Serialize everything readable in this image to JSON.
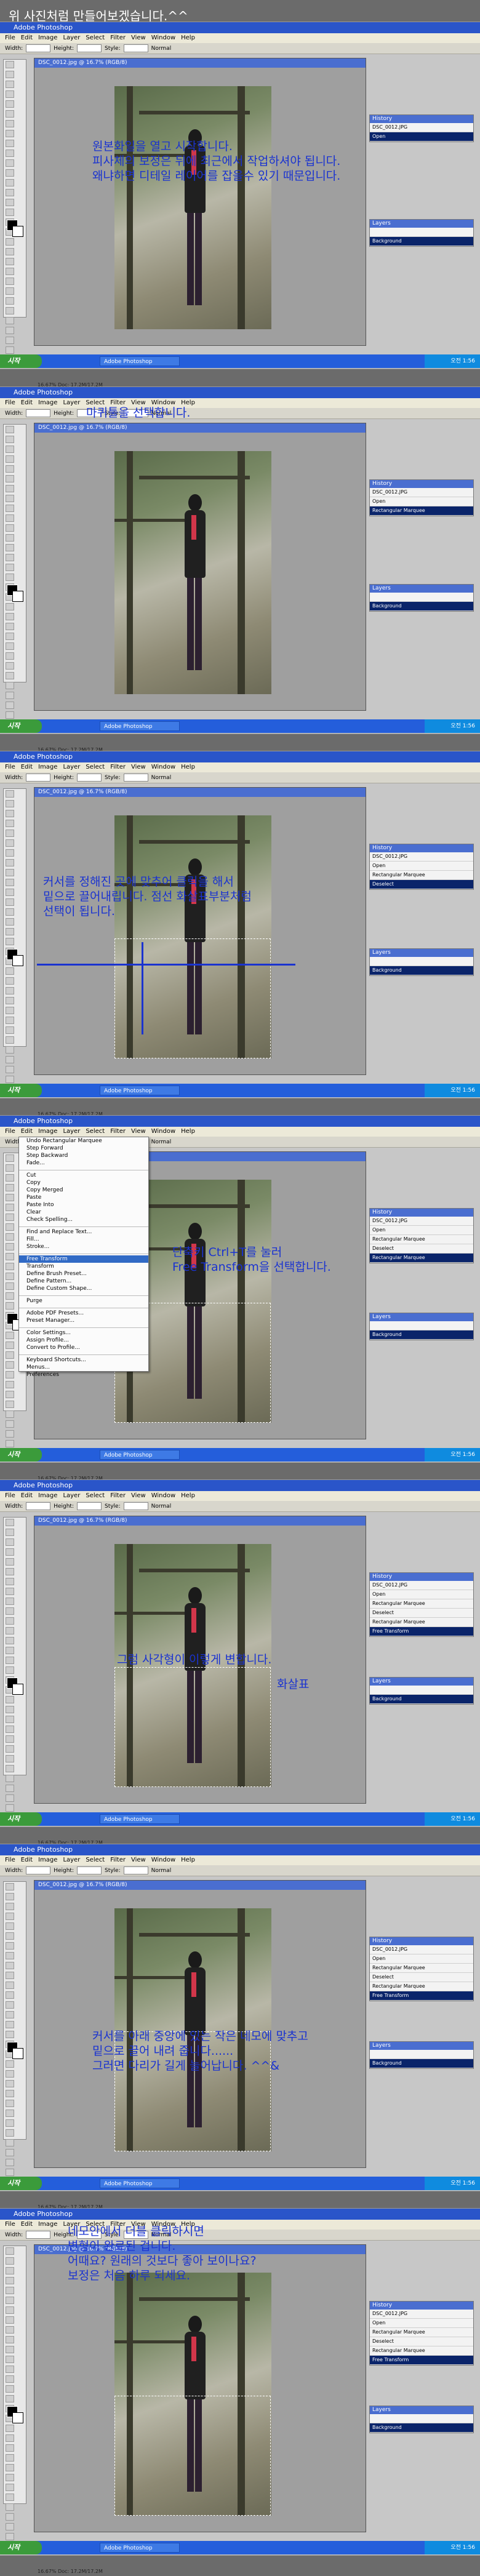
{
  "page": {
    "caption": "위 사진처럼 만들어보겠습니다.^^"
  },
  "app": {
    "window_title": "Adobe Photoshop",
    "menu": [
      "File",
      "Edit",
      "Image",
      "Layer",
      "Select",
      "Filter",
      "View",
      "Window",
      "Help"
    ],
    "options_style_label": "Style:",
    "options_style_value": "Normal",
    "options_width_label": "Width:",
    "options_height_label": "Height:",
    "start_label": "시작",
    "task_label": "Adobe Photoshop",
    "tray_time": "오전 1:56"
  },
  "document": {
    "title": "DSC_0012.jpg @ 16.7% (RGB/8)",
    "status_zoom": "16.67%",
    "status_doc": "Doc: 17.2M/17.2M"
  },
  "panels": {
    "history_title": "History",
    "layers_title": "Layers",
    "layer_name": "Background",
    "history_source": "DSC_0012.JPG",
    "history_items": [
      "Open",
      "Rectangular Marquee",
      "Deselect",
      "Rectangular Marquee",
      "Free Transform"
    ]
  },
  "edit_menu": {
    "items": [
      "Undo Rectangular Marquee",
      "Step Forward",
      "Step Backward",
      "Fade...",
      "Cut",
      "Copy",
      "Copy Merged",
      "Paste",
      "Paste Into",
      "Clear",
      "Check Spelling...",
      "Find and Replace Text...",
      "Fill...",
      "Stroke...",
      "Free Transform",
      "Transform",
      "Define Brush Preset...",
      "Define Pattern...",
      "Define Custom Shape...",
      "Purge",
      "Adobe PDF Presets...",
      "Preset Manager...",
      "Color Settings...",
      "Assign Profile...",
      "Convert to Profile...",
      "Keyboard Shortcuts...",
      "Menus...",
      "Preferences"
    ],
    "highlighted": "Free Transform"
  },
  "steps": [
    {
      "annotation": "원본화일을 열고 시작합니다.\n피사체의 보정은 뒤에 최근에서 작업하셔야 됩니다.\n왜냐하면 디테일 레이어를 잡을수 있기 때문입니다."
    },
    {
      "annotation": "마퀴툴을 선택합니다."
    },
    {
      "annotation": "커서를 정해진 곳에 맞추어 클릭을 해서\n밑으로 끌어내립니다. 점선 화살표부분처럼\n선택이 됩니다."
    },
    {
      "annotation": "단축키 Ctrl+T를 눌러\nFree Transform을 선택합니다."
    },
    {
      "annotation": "그럼 사각형이 이렇게 변합니다.",
      "label2": "화살표"
    },
    {
      "annotation": "커서를 아래 중앙에 있는 작은 네모에 맞추고\n밑으로 끌어 내려 줍니다......\n그러면 다리가 길게 늘어납니다. ^^&"
    },
    {
      "annotation": "네모안에서 더블 클릭하시면\n변형이 완료된 겁니다.\n어때요? 원래의 것보다 좋아 보이나요?\n보정은 처음 하루 되세요."
    }
  ]
}
